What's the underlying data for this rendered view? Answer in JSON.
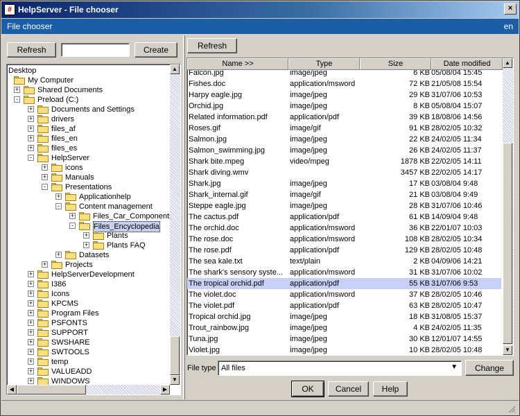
{
  "window": {
    "app_icon": "hash-icon",
    "title": "HelpServer - File chooser",
    "close_label": "×"
  },
  "header": {
    "left": "File chooser",
    "right": "en"
  },
  "left_panel": {
    "refresh_label": "Refresh",
    "folder_input_value": "",
    "create_label": "Create",
    "tree": [
      {
        "label": "Desktop",
        "depth": 0,
        "exp": "",
        "folder": false
      },
      {
        "label": "My Computer",
        "depth": 1,
        "exp": "",
        "folder": true
      },
      {
        "label": "Shared Documents",
        "depth": 1,
        "exp": "+",
        "folder": true
      },
      {
        "label": "Preload (C:)",
        "depth": 1,
        "exp": "-",
        "folder": true
      },
      {
        "label": "Documents and Settings",
        "depth": 2,
        "exp": "+",
        "folder": true
      },
      {
        "label": "drivers",
        "depth": 2,
        "exp": "+",
        "folder": true
      },
      {
        "label": "files_af",
        "depth": 2,
        "exp": "+",
        "folder": true
      },
      {
        "label": "files_en",
        "depth": 2,
        "exp": "+",
        "folder": true
      },
      {
        "label": "files_es",
        "depth": 2,
        "exp": "+",
        "folder": true
      },
      {
        "label": "HelpServer",
        "depth": 2,
        "exp": "-",
        "folder": true
      },
      {
        "label": "icons",
        "depth": 3,
        "exp": "+",
        "folder": true
      },
      {
        "label": "Manuals",
        "depth": 3,
        "exp": "+",
        "folder": true
      },
      {
        "label": "Presentations",
        "depth": 3,
        "exp": "-",
        "folder": true
      },
      {
        "label": "Applicationhelp",
        "depth": 4,
        "exp": "+",
        "folder": true
      },
      {
        "label": "Content management",
        "depth": 4,
        "exp": "-",
        "folder": true
      },
      {
        "label": "Files_Car_Components",
        "depth": 5,
        "exp": "+",
        "folder": true
      },
      {
        "label": "Files_Encyclopedia",
        "depth": 5,
        "exp": "-",
        "folder": true,
        "selected": true
      },
      {
        "label": "Plants",
        "depth": 6,
        "exp": "+",
        "folder": true
      },
      {
        "label": "Plants FAQ",
        "depth": 6,
        "exp": "+",
        "folder": true
      },
      {
        "label": "Datasets",
        "depth": 4,
        "exp": "+",
        "folder": true
      },
      {
        "label": "Projects",
        "depth": 3,
        "exp": "+",
        "folder": true
      },
      {
        "label": "HelpServerDevelopment",
        "depth": 2,
        "exp": "+",
        "folder": true
      },
      {
        "label": "I386",
        "depth": 2,
        "exp": "+",
        "folder": true
      },
      {
        "label": "Icons",
        "depth": 2,
        "exp": "+",
        "folder": true
      },
      {
        "label": "KPCMS",
        "depth": 2,
        "exp": "+",
        "folder": true
      },
      {
        "label": "Program Files",
        "depth": 2,
        "exp": "+",
        "folder": true
      },
      {
        "label": "PSFONTS",
        "depth": 2,
        "exp": "+",
        "folder": true
      },
      {
        "label": "SUPPORT",
        "depth": 2,
        "exp": "+",
        "folder": true
      },
      {
        "label": "SWSHARE",
        "depth": 2,
        "exp": "+",
        "folder": true
      },
      {
        "label": "SWTOOLS",
        "depth": 2,
        "exp": "+",
        "folder": true
      },
      {
        "label": "temp",
        "depth": 2,
        "exp": "+",
        "folder": true
      },
      {
        "label": "VALUEADD",
        "depth": 2,
        "exp": "+",
        "folder": true
      },
      {
        "label": "WINDOWS",
        "depth": 2,
        "exp": "+",
        "folder": true
      }
    ]
  },
  "right_panel": {
    "refresh_label": "Refresh",
    "columns": [
      "Name >>",
      "Type",
      "Size",
      "Date modified"
    ],
    "files": [
      [
        "Falcon.jpg",
        "image/jpeg",
        "6 KB",
        "05/08/04 15:45"
      ],
      [
        "Fishes.doc",
        "application/msword",
        "72 KB",
        "21/05/08 15:54"
      ],
      [
        "Harpy eagle.jpg",
        "image/jpeg",
        "29 KB",
        "31/07/06 10:53"
      ],
      [
        "Orchid.jpg",
        "image/jpeg",
        "8 KB",
        "05/08/04 15:07"
      ],
      [
        "Related information.pdf",
        "application/pdf",
        "39 KB",
        "18/08/06 14:56"
      ],
      [
        "Roses.gif",
        "image/gif",
        "91 KB",
        "28/02/05 10:32"
      ],
      [
        "Salmon.jpg",
        "image/jpeg",
        "22 KB",
        "24/02/05 11:34"
      ],
      [
        "Salmon_swimming.jpg",
        "image/jpeg",
        "26 KB",
        "24/02/05 11:37"
      ],
      [
        "Shark bite.mpeg",
        "video/mpeg",
        "1878 KB",
        "22/02/05 14:11"
      ],
      [
        "Shark diving.wmv",
        "",
        "3457 KB",
        "22/02/05 14:17"
      ],
      [
        "Shark.jpg",
        "image/jpeg",
        "17 KB",
        "03/08/04 9:48"
      ],
      [
        "Shark_internal.gif",
        "image/gif",
        "21 KB",
        "03/08/04 9:49"
      ],
      [
        "Steppe eagle.jpg",
        "image/jpeg",
        "28 KB",
        "31/07/06 10:46"
      ],
      [
        "The cactus.pdf",
        "application/pdf",
        "61 KB",
        "14/09/04 9:48"
      ],
      [
        "The orchid.doc",
        "application/msword",
        "36 KB",
        "22/01/07 10:03"
      ],
      [
        "The rose.doc",
        "application/msword",
        "108 KB",
        "28/02/05 10:34"
      ],
      [
        "The rose.pdf",
        "application/pdf",
        "129 KB",
        "28/02/05 10:48"
      ],
      [
        "The sea kale.txt",
        "text/plain",
        "2 KB",
        "04/09/06 14:21"
      ],
      [
        "The shark's sensory syste...",
        "application/msword",
        "31 KB",
        "31/07/06 10:02"
      ],
      [
        "The tropical orchid.pdf",
        "application/pdf",
        "55 KB",
        "31/07/06 9:53"
      ],
      [
        "The violet.doc",
        "application/msword",
        "37 KB",
        "28/02/05 10:46"
      ],
      [
        "The violet.pdf",
        "application/pdf",
        "63 KB",
        "28/02/05 10:47"
      ],
      [
        "Tropical orchid.jpg",
        "image/jpeg",
        "18 KB",
        "31/08/05 15:37"
      ],
      [
        "Trout_rainbow.jpg",
        "image/jpeg",
        "4 KB",
        "24/02/05 11:35"
      ],
      [
        "Tuna.jpg",
        "image/jpeg",
        "30 KB",
        "12/01/07 14:55"
      ],
      [
        "Violet.jpg",
        "image/jpeg",
        "10 KB",
        "28/02/05 10:48"
      ]
    ],
    "selected_index": 19,
    "file_type_label": "File type",
    "file_type_value": "All files",
    "change_label": "Change",
    "ok_label": "OK",
    "cancel_label": "Cancel",
    "help_label": "Help"
  }
}
